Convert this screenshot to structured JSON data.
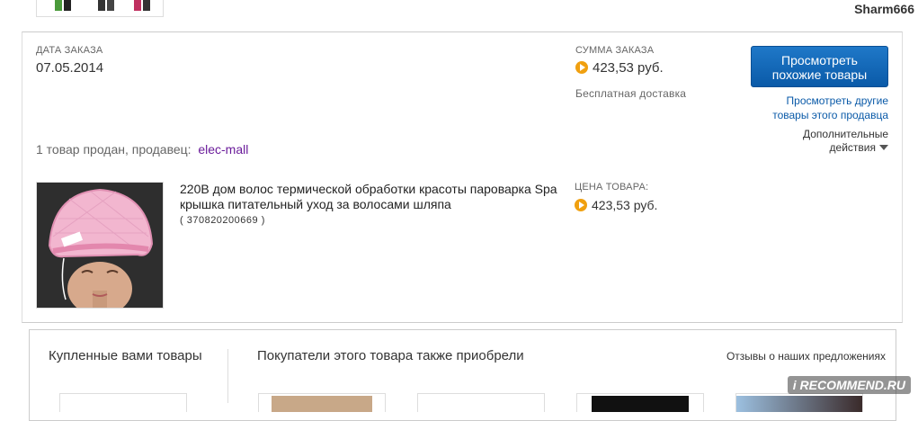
{
  "header": {
    "username": "Sharm666"
  },
  "order": {
    "date_label": "ДАТА ЗАКАЗА",
    "date_value": "07.05.2014",
    "sum_label": "СУММА ЗАКАЗА",
    "sum_value": "423,53 руб.",
    "shipping": "Бесплатная доставка",
    "seller_prefix": "1 товар продан, продавец:",
    "seller_name": "elec-mall"
  },
  "actions": {
    "primary_button": "Просмотреть похожие товары",
    "other_items_link": "Просмотреть другие товары этого продавца",
    "more_actions": "Дополнительные действия"
  },
  "item": {
    "title": "220В дом волос термической обработки красоты пароварка Spa крышка питательный уход за волосами шляпа",
    "id": "( 370820200669 )",
    "price_label": "ЦЕНА ТОВАРА:",
    "price_value": "423,53 руб."
  },
  "bottom": {
    "bought_title": "Купленные вами товары",
    "also_bought_title": "Покупатели этого товара также приобрели",
    "reviews_link": "Отзывы о наших предложениях"
  },
  "watermark": "i RECOMMEND.RU",
  "colors": {
    "primary": "#0a5aa8",
    "coin": "#f0a010",
    "seller": "#6a1b9a"
  }
}
